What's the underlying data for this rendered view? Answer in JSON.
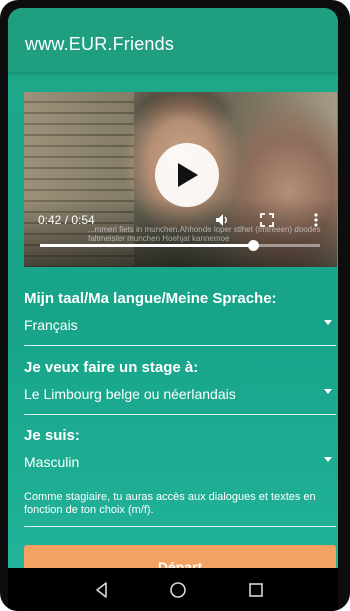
{
  "app": {
    "title": "www.EUR.Friends"
  },
  "video": {
    "time": "0:42 / 0:54",
    "subtitle": "...mmeri fiets in munchen.Ahhonde loper stlhet (Imtreeen) doodes faltmeister munchen Hoehjat kannemoe",
    "progress_fraction": 0.76,
    "icons": {
      "play": "play-icon",
      "volume": "volume-icon",
      "fullscreen": "fullscreen-icon",
      "more": "more-vert-icon"
    }
  },
  "form": {
    "language": {
      "label": "Mijn taal/Ma langue/Meine Sprache:",
      "value": "Français"
    },
    "internship": {
      "label": "Je veux faire un stage à:",
      "value": "Le Limbourg belge ou néerlandais"
    },
    "gender": {
      "label": "Je suis:",
      "value": "Masculin",
      "helper": "Comme stagiaire, tu auras accès aux dialogues et textes en fonction de ton choix (m/f)."
    },
    "start_label": "Départ"
  },
  "navbar": {
    "icons": [
      "back-icon",
      "home-icon",
      "recents-icon"
    ]
  },
  "colors": {
    "primary": "#1f9e80",
    "background": "#1fa98a",
    "accent": "#f3a262",
    "text": "#ffffff"
  }
}
